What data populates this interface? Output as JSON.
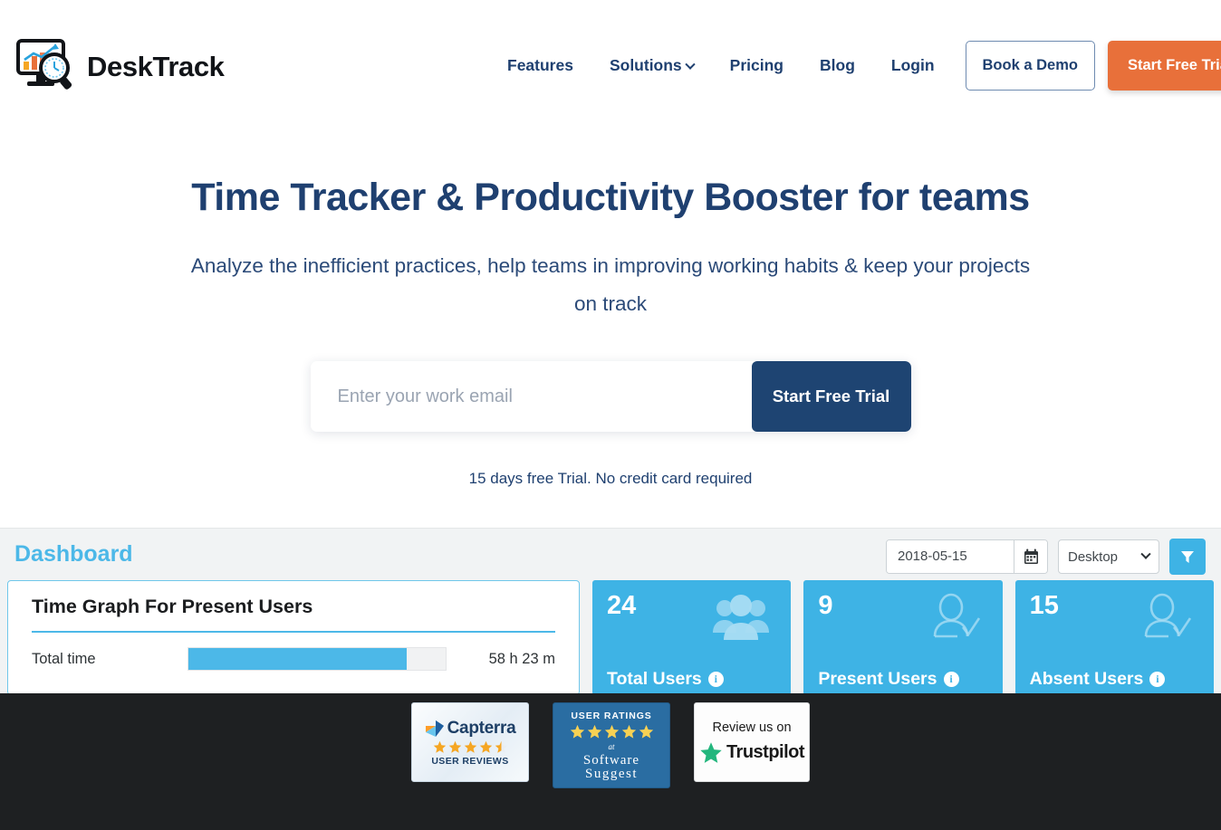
{
  "brand": {
    "name": "DeskTrack",
    "logo_icon": "monitor-chart-magnifier-clock-icon",
    "accent_orange": "#e8703a",
    "accent_navy": "#1e4472",
    "accent_blue": "#3eb3e5"
  },
  "nav": {
    "links": [
      {
        "label": "Features",
        "icon": ""
      },
      {
        "label": "Solutions",
        "icon": "chevron-down-icon"
      },
      {
        "label": "Pricing",
        "icon": ""
      },
      {
        "label": "Blog",
        "icon": ""
      },
      {
        "label": "Login",
        "icon": ""
      }
    ],
    "demo_button": "Book a Demo",
    "trial_button": "Start Free Trial"
  },
  "hero": {
    "title": "Time Tracker & Productivity Booster for teams",
    "subtitle": "Analyze the inefficient practices, help teams in improving working habits & keep your projects on track",
    "email_placeholder": "Enter your work email",
    "email_value": "",
    "cta_label": "Start Free Trial",
    "note": "15 days free Trial. No credit card required"
  },
  "dashboard": {
    "title": "Dashboard",
    "date_value": "2018-05-15",
    "calendar_icon": "calendar-icon",
    "device_select_value": "Desktop",
    "device_select_icon": "chevron-down-icon",
    "filter_icon": "funnel-icon",
    "graph": {
      "title": "Time Graph For Present Users",
      "row_label": "Total time",
      "row_value": "58 h 23 m",
      "fill_percent": 85
    },
    "stats": [
      {
        "value": "24",
        "label": "Total Users",
        "icon": "users-group-icon",
        "info": "i"
      },
      {
        "value": "9",
        "label": "Present Users",
        "icon": "user-check-icon",
        "info": "i"
      },
      {
        "value": "15",
        "label": "Absent Users",
        "icon": "user-check-icon",
        "info": "i"
      }
    ]
  },
  "chart_data": {
    "type": "bar",
    "title": "Time Graph For Present Users",
    "categories": [
      "Total time"
    ],
    "values": [
      58.383
    ],
    "value_labels": [
      "58 h 23 m"
    ],
    "unit": "hours",
    "fill_percent": [
      85
    ],
    "xlabel": "",
    "ylabel": "",
    "legend": "none",
    "grid": false
  },
  "footer_badges": [
    {
      "id": "capterra",
      "name": "Capterra",
      "caption": "USER REVIEWS",
      "stars": 4.5,
      "icon": "capterra-logo-icon"
    },
    {
      "id": "software-suggest",
      "top_text": "USER RATINGS",
      "at_text": "at",
      "name_line1": "Software",
      "name_line2": "Suggest",
      "stars": 5,
      "icon": "software-suggest-logo-icon"
    },
    {
      "id": "trustpilot",
      "top_text": "Review us on",
      "name": "Trustpilot",
      "icon": "trustpilot-star-icon"
    }
  ]
}
